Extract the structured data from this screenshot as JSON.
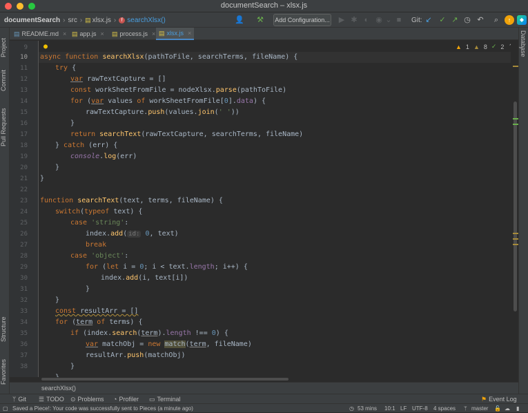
{
  "window": {
    "title": "documentSearch – xlsx.js"
  },
  "navbar": {
    "project": "documentSearch",
    "folder": "src",
    "file": "xlsx.js",
    "symbol": "searchXlsx()",
    "add_config": "Add Configuration...",
    "git_label": "Git:"
  },
  "tabs": [
    {
      "label": "README.md"
    },
    {
      "label": "app.js"
    },
    {
      "label": "process.js"
    },
    {
      "label": "xlsx.js"
    }
  ],
  "left_tools": {
    "project": "Project",
    "commit": "Commit",
    "pull": "Pull Requests",
    "structure": "Structure",
    "favorites": "Favorites"
  },
  "right_tools": {
    "database": "Database"
  },
  "inspections": {
    "warnings": "1",
    "weak": "8",
    "ok": "2"
  },
  "line_numbers": [
    "9",
    "10",
    "11",
    "12",
    "13",
    "14",
    "15",
    "16",
    "17",
    "18",
    "19",
    "20",
    "21",
    "22",
    "23",
    "24",
    "25",
    "26",
    "27",
    "28",
    "29",
    "30",
    "31",
    "32",
    "33",
    "34",
    "35",
    "36",
    "37",
    "38"
  ],
  "code": {
    "l10": {
      "a": "async ",
      "b": "function ",
      "c": "searchXlsx",
      "d": "(pathToFile, searchTerms, fileName) {"
    },
    "l11": {
      "a": "try",
      "b": " {"
    },
    "l12": {
      "a": "var",
      "b": " rawTextCapture = []"
    },
    "l13": {
      "a": "const ",
      "b": "workSheetFromFile = nodeXlsx.",
      "c": "parse",
      "d": "(pathToFile)"
    },
    "l14": {
      "a": "for ",
      "b": "(",
      "c": "var",
      "d": " values ",
      "e": "of ",
      "f": "workSheetFromFile[",
      "g": "0",
      "h": "].",
      "i": "data",
      "j": ") {"
    },
    "l15": {
      "a": "rawTextCapture.",
      "b": "push",
      "c": "(values.",
      "d": "join",
      "e": "(",
      "f": "' '",
      "g": "))"
    },
    "l16": {
      "a": "}"
    },
    "l17": {
      "a": "return ",
      "b": "searchText",
      "c": "(rawTextCapture, searchTerms, fileName)"
    },
    "l18": {
      "a": "} ",
      "b": "catch ",
      "c": "(err) {"
    },
    "l19": {
      "a": "console",
      "b": ".",
      "c": "log",
      "d": "(err)"
    },
    "l20": {
      "a": "}"
    },
    "l21": {
      "a": "}"
    },
    "l23": {
      "a": "function ",
      "b": "searchText",
      "c": "(text, terms, fileName) {"
    },
    "l24": {
      "a": "switch",
      "b": "(",
      "c": "typeof ",
      "d": "text) {"
    },
    "l25": {
      "a": "case ",
      "b": "'string'",
      "c": ":"
    },
    "l26": {
      "a": "index.",
      "b": "add",
      "c": "(",
      "hint": "id:",
      "d": " 0",
      "e": ", text)"
    },
    "l27": {
      "a": "break"
    },
    "l28": {
      "a": "case ",
      "b": "'object'",
      "c": ":"
    },
    "l29": {
      "a": "for ",
      "b": "(",
      "c": "let ",
      "d": "i = ",
      "e": "0",
      "f": "; i < text.",
      "g": "length",
      "h": "; i++) {"
    },
    "l30": {
      "a": "index.",
      "b": "add",
      "c": "(i, text[i])"
    },
    "l31": {
      "a": "}"
    },
    "l32": {
      "a": "}"
    },
    "l33": {
      "a": "const ",
      "b": "resultArr = []"
    },
    "l34": {
      "a": "for ",
      "b": "(",
      "c": "term",
      "d": " of ",
      "e": "terms) {"
    },
    "l35": {
      "a": "if ",
      "b": "(index.",
      "c": "search",
      "d": "(",
      "e": "term",
      "f": ").",
      "g": "length",
      "h": " !== ",
      "i": "0",
      "j": ") {"
    },
    "l36": {
      "a": "var",
      "b": " matchObj = ",
      "c": "new ",
      "d": "match",
      "e": "(",
      "f": "term",
      "g": ", fileName)"
    },
    "l37": {
      "a": "resultArr.",
      "b": "push",
      "c": "(matchObj)"
    },
    "l38": {
      "a": "}"
    },
    "l39": {
      "a": "}"
    }
  },
  "breadcrumb": {
    "label": "searchXlsx()"
  },
  "toolwindows": [
    "Git",
    "TODO",
    "Problems",
    "Profiler",
    "Terminal"
  ],
  "event_log": "Event Log",
  "status": {
    "message": "Saved a Piece!: Your code was successfully sent to Pieces (a minute ago)",
    "time": "53 mins",
    "position": "10:1",
    "line_sep": "LF",
    "encoding": "UTF-8",
    "indent": "4 spaces",
    "branch": "master"
  },
  "colors": {
    "keyword": "#cc7832",
    "function": "#ffc66d",
    "string": "#6a8759",
    "number": "#6897bb",
    "accent": "#4a88c7"
  }
}
